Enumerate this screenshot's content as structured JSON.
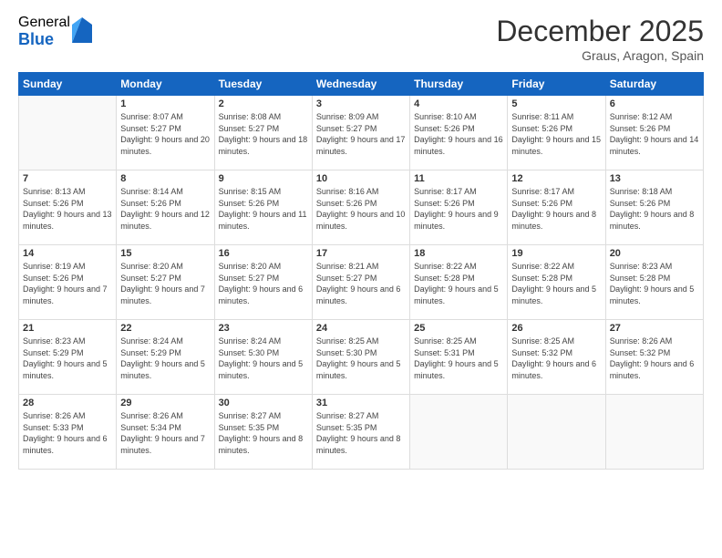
{
  "logo": {
    "general": "General",
    "blue": "Blue"
  },
  "header": {
    "month": "December 2025",
    "location": "Graus, Aragon, Spain"
  },
  "weekdays": [
    "Sunday",
    "Monday",
    "Tuesday",
    "Wednesday",
    "Thursday",
    "Friday",
    "Saturday"
  ],
  "weeks": [
    [
      {
        "day": "",
        "sunrise": "",
        "sunset": "",
        "daylight": ""
      },
      {
        "day": "1",
        "sunrise": "Sunrise: 8:07 AM",
        "sunset": "Sunset: 5:27 PM",
        "daylight": "Daylight: 9 hours and 20 minutes."
      },
      {
        "day": "2",
        "sunrise": "Sunrise: 8:08 AM",
        "sunset": "Sunset: 5:27 PM",
        "daylight": "Daylight: 9 hours and 18 minutes."
      },
      {
        "day": "3",
        "sunrise": "Sunrise: 8:09 AM",
        "sunset": "Sunset: 5:27 PM",
        "daylight": "Daylight: 9 hours and 17 minutes."
      },
      {
        "day": "4",
        "sunrise": "Sunrise: 8:10 AM",
        "sunset": "Sunset: 5:26 PM",
        "daylight": "Daylight: 9 hours and 16 minutes."
      },
      {
        "day": "5",
        "sunrise": "Sunrise: 8:11 AM",
        "sunset": "Sunset: 5:26 PM",
        "daylight": "Daylight: 9 hours and 15 minutes."
      },
      {
        "day": "6",
        "sunrise": "Sunrise: 8:12 AM",
        "sunset": "Sunset: 5:26 PM",
        "daylight": "Daylight: 9 hours and 14 minutes."
      }
    ],
    [
      {
        "day": "7",
        "sunrise": "Sunrise: 8:13 AM",
        "sunset": "Sunset: 5:26 PM",
        "daylight": "Daylight: 9 hours and 13 minutes."
      },
      {
        "day": "8",
        "sunrise": "Sunrise: 8:14 AM",
        "sunset": "Sunset: 5:26 PM",
        "daylight": "Daylight: 9 hours and 12 minutes."
      },
      {
        "day": "9",
        "sunrise": "Sunrise: 8:15 AM",
        "sunset": "Sunset: 5:26 PM",
        "daylight": "Daylight: 9 hours and 11 minutes."
      },
      {
        "day": "10",
        "sunrise": "Sunrise: 8:16 AM",
        "sunset": "Sunset: 5:26 PM",
        "daylight": "Daylight: 9 hours and 10 minutes."
      },
      {
        "day": "11",
        "sunrise": "Sunrise: 8:17 AM",
        "sunset": "Sunset: 5:26 PM",
        "daylight": "Daylight: 9 hours and 9 minutes."
      },
      {
        "day": "12",
        "sunrise": "Sunrise: 8:17 AM",
        "sunset": "Sunset: 5:26 PM",
        "daylight": "Daylight: 9 hours and 8 minutes."
      },
      {
        "day": "13",
        "sunrise": "Sunrise: 8:18 AM",
        "sunset": "Sunset: 5:26 PM",
        "daylight": "Daylight: 9 hours and 8 minutes."
      }
    ],
    [
      {
        "day": "14",
        "sunrise": "Sunrise: 8:19 AM",
        "sunset": "Sunset: 5:26 PM",
        "daylight": "Daylight: 9 hours and 7 minutes."
      },
      {
        "day": "15",
        "sunrise": "Sunrise: 8:20 AM",
        "sunset": "Sunset: 5:27 PM",
        "daylight": "Daylight: 9 hours and 7 minutes."
      },
      {
        "day": "16",
        "sunrise": "Sunrise: 8:20 AM",
        "sunset": "Sunset: 5:27 PM",
        "daylight": "Daylight: 9 hours and 6 minutes."
      },
      {
        "day": "17",
        "sunrise": "Sunrise: 8:21 AM",
        "sunset": "Sunset: 5:27 PM",
        "daylight": "Daylight: 9 hours and 6 minutes."
      },
      {
        "day": "18",
        "sunrise": "Sunrise: 8:22 AM",
        "sunset": "Sunset: 5:28 PM",
        "daylight": "Daylight: 9 hours and 5 minutes."
      },
      {
        "day": "19",
        "sunrise": "Sunrise: 8:22 AM",
        "sunset": "Sunset: 5:28 PM",
        "daylight": "Daylight: 9 hours and 5 minutes."
      },
      {
        "day": "20",
        "sunrise": "Sunrise: 8:23 AM",
        "sunset": "Sunset: 5:28 PM",
        "daylight": "Daylight: 9 hours and 5 minutes."
      }
    ],
    [
      {
        "day": "21",
        "sunrise": "Sunrise: 8:23 AM",
        "sunset": "Sunset: 5:29 PM",
        "daylight": "Daylight: 9 hours and 5 minutes."
      },
      {
        "day": "22",
        "sunrise": "Sunrise: 8:24 AM",
        "sunset": "Sunset: 5:29 PM",
        "daylight": "Daylight: 9 hours and 5 minutes."
      },
      {
        "day": "23",
        "sunrise": "Sunrise: 8:24 AM",
        "sunset": "Sunset: 5:30 PM",
        "daylight": "Daylight: 9 hours and 5 minutes."
      },
      {
        "day": "24",
        "sunrise": "Sunrise: 8:25 AM",
        "sunset": "Sunset: 5:30 PM",
        "daylight": "Daylight: 9 hours and 5 minutes."
      },
      {
        "day": "25",
        "sunrise": "Sunrise: 8:25 AM",
        "sunset": "Sunset: 5:31 PM",
        "daylight": "Daylight: 9 hours and 5 minutes."
      },
      {
        "day": "26",
        "sunrise": "Sunrise: 8:25 AM",
        "sunset": "Sunset: 5:32 PM",
        "daylight": "Daylight: 9 hours and 6 minutes."
      },
      {
        "day": "27",
        "sunrise": "Sunrise: 8:26 AM",
        "sunset": "Sunset: 5:32 PM",
        "daylight": "Daylight: 9 hours and 6 minutes."
      }
    ],
    [
      {
        "day": "28",
        "sunrise": "Sunrise: 8:26 AM",
        "sunset": "Sunset: 5:33 PM",
        "daylight": "Daylight: 9 hours and 6 minutes."
      },
      {
        "day": "29",
        "sunrise": "Sunrise: 8:26 AM",
        "sunset": "Sunset: 5:34 PM",
        "daylight": "Daylight: 9 hours and 7 minutes."
      },
      {
        "day": "30",
        "sunrise": "Sunrise: 8:27 AM",
        "sunset": "Sunset: 5:35 PM",
        "daylight": "Daylight: 9 hours and 8 minutes."
      },
      {
        "day": "31",
        "sunrise": "Sunrise: 8:27 AM",
        "sunset": "Sunset: 5:35 PM",
        "daylight": "Daylight: 9 hours and 8 minutes."
      },
      {
        "day": "",
        "sunrise": "",
        "sunset": "",
        "daylight": ""
      },
      {
        "day": "",
        "sunrise": "",
        "sunset": "",
        "daylight": ""
      },
      {
        "day": "",
        "sunrise": "",
        "sunset": "",
        "daylight": ""
      }
    ]
  ]
}
